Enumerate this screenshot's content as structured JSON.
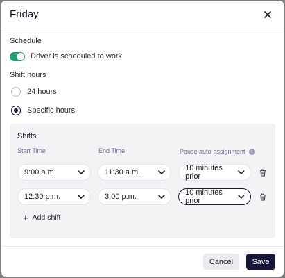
{
  "dialog": {
    "title": "Friday",
    "close_icon": "close-icon"
  },
  "schedule": {
    "label": "Schedule",
    "toggle_label": "Driver is scheduled to work",
    "toggle_on": true,
    "toggle_color": "#1fa06a"
  },
  "shift_hours": {
    "label": "Shift hours",
    "options": [
      {
        "label": "24 hours",
        "selected": false
      },
      {
        "label": "Specific hours",
        "selected": true
      }
    ]
  },
  "shifts": {
    "title": "Shifts",
    "columns": {
      "start": "Start Time",
      "end": "End Time",
      "pause": "Pause auto-assignment",
      "pause_info": "i"
    },
    "rows": [
      {
        "start": "9:00 a.m.",
        "end": "11:30 a.m.",
        "pause": "10 minutes prior"
      },
      {
        "start": "12:30 p.m.",
        "end": "3:00 p.m.",
        "pause": "10 minutes prior"
      }
    ],
    "add_label": "Add shift",
    "add_icon": "+"
  },
  "footer": {
    "cancel_label": "Cancel",
    "save_label": "Save",
    "save_color": "#16163a"
  }
}
